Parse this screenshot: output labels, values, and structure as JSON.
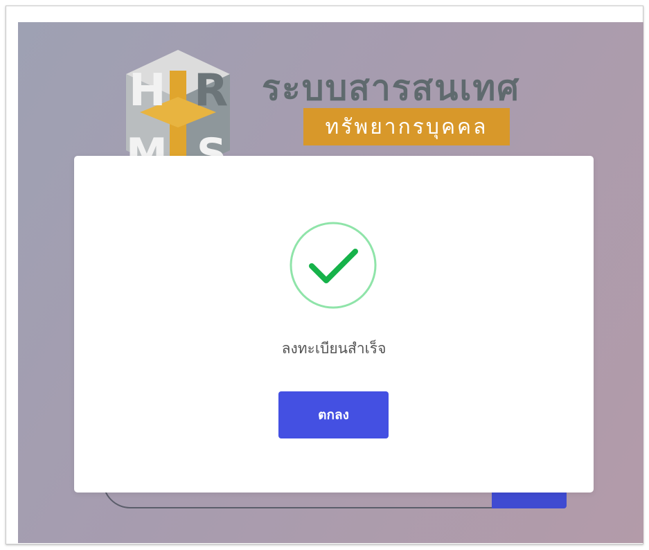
{
  "background": {
    "logo": {
      "mark_letters": [
        "H",
        "R",
        "M",
        "S"
      ],
      "title": "ระบบสารสนเทศ",
      "subtitle": "ทรัพยากรบุคคล",
      "colors": {
        "title": "#5f6a6e",
        "subtitle_bg": "#d8982a",
        "subtitle_text": "#ffffff"
      }
    },
    "colors": {
      "overlay_start": "#9ea1b3",
      "overlay_end": "#b39ba9",
      "submit_button": "#3f4bd1"
    }
  },
  "modal": {
    "icon": "success-check-icon",
    "message": "ลงทะเบียนสำเร็จ",
    "confirm_label": "ตกลง",
    "colors": {
      "check": "#16b24a",
      "ring": "#8fe4a9",
      "button": "#4450e2"
    }
  }
}
